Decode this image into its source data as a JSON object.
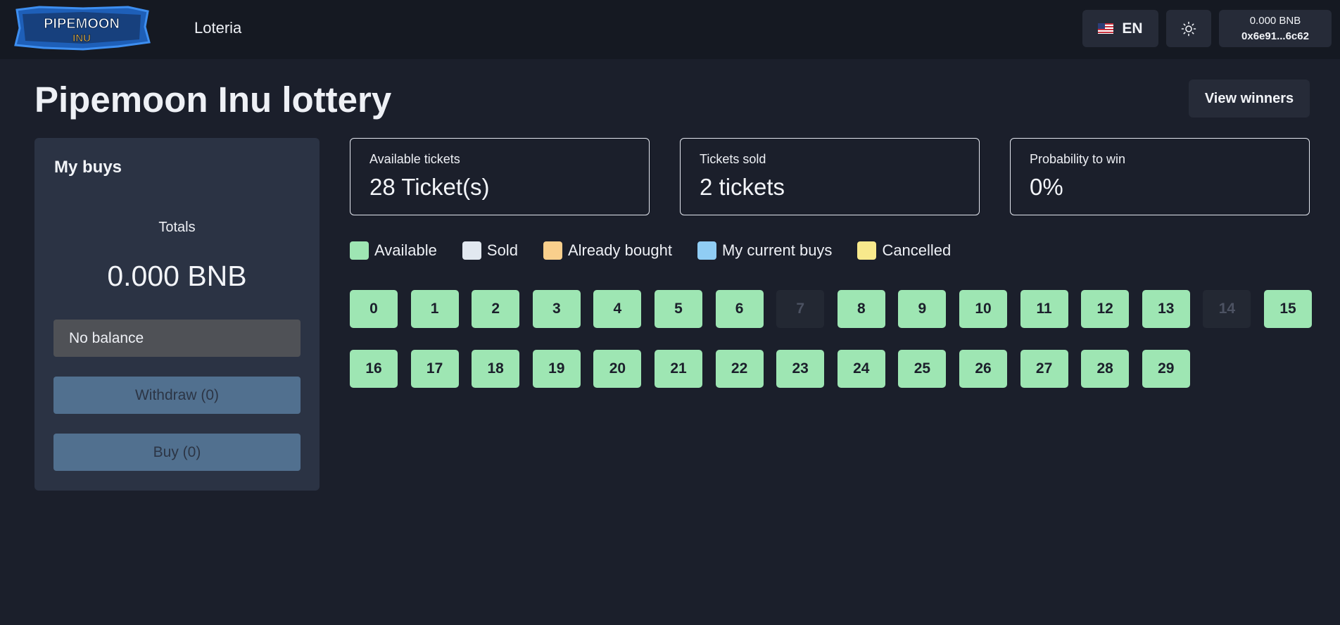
{
  "header": {
    "logo_text": "PIPEMOON",
    "logo_subtext": "INU",
    "nav_link": "Loteria",
    "language": "EN",
    "wallet_balance": "0.000 BNB",
    "wallet_address": "0x6e91...6c62"
  },
  "page_title": "Pipemoon Inu lottery",
  "view_winners_label": "View winners",
  "my_buys": {
    "title": "My buys",
    "totals_label": "Totals",
    "totals_value": "0.000 BNB",
    "balance_status": "No balance",
    "withdraw_label": "Withdraw (0)",
    "buy_label": "Buy (0)"
  },
  "stats": {
    "available": {
      "label": "Available tickets",
      "value": "28 Ticket(s)"
    },
    "sold": {
      "label": "Tickets sold",
      "value": "2 tickets"
    },
    "probability": {
      "label": "Probability to win",
      "value": "0%"
    }
  },
  "legend": [
    {
      "label": "Available",
      "color": "#9ee6b3"
    },
    {
      "label": "Sold",
      "color": "#e2e8f0"
    },
    {
      "label": "Already bought",
      "color": "#f9cf8c"
    },
    {
      "label": "My current buys",
      "color": "#90cdf4"
    },
    {
      "label": "Cancelled",
      "color": "#f8e98c"
    }
  ],
  "tickets": [
    {
      "number": "0",
      "state": "available"
    },
    {
      "number": "1",
      "state": "available"
    },
    {
      "number": "2",
      "state": "available"
    },
    {
      "number": "3",
      "state": "available"
    },
    {
      "number": "4",
      "state": "available"
    },
    {
      "number": "5",
      "state": "available"
    },
    {
      "number": "6",
      "state": "available"
    },
    {
      "number": "7",
      "state": "disabled"
    },
    {
      "number": "8",
      "state": "available"
    },
    {
      "number": "9",
      "state": "available"
    },
    {
      "number": "10",
      "state": "available"
    },
    {
      "number": "11",
      "state": "available"
    },
    {
      "number": "12",
      "state": "available"
    },
    {
      "number": "13",
      "state": "available"
    },
    {
      "number": "14",
      "state": "disabled"
    },
    {
      "number": "15",
      "state": "available"
    },
    {
      "number": "16",
      "state": "available"
    },
    {
      "number": "17",
      "state": "available"
    },
    {
      "number": "18",
      "state": "available"
    },
    {
      "number": "19",
      "state": "available"
    },
    {
      "number": "20",
      "state": "available"
    },
    {
      "number": "21",
      "state": "available"
    },
    {
      "number": "22",
      "state": "available"
    },
    {
      "number": "23",
      "state": "available"
    },
    {
      "number": "24",
      "state": "available"
    },
    {
      "number": "25",
      "state": "available"
    },
    {
      "number": "26",
      "state": "available"
    },
    {
      "number": "27",
      "state": "available"
    },
    {
      "number": "28",
      "state": "available"
    },
    {
      "number": "29",
      "state": "available"
    }
  ]
}
